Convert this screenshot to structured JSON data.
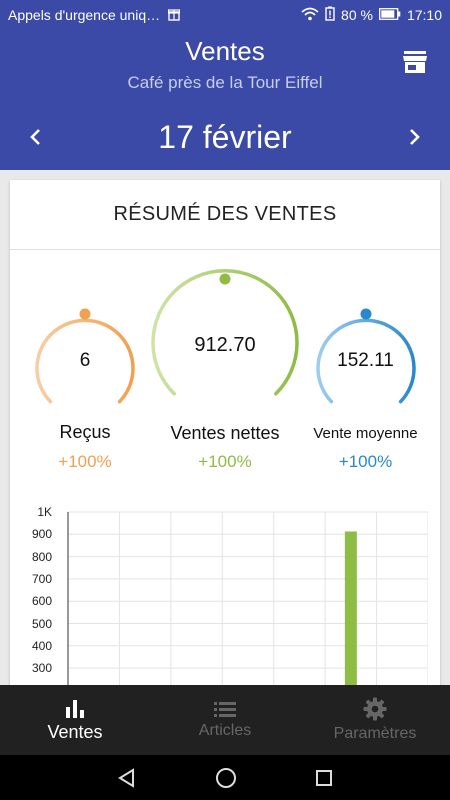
{
  "status_bar": {
    "notification": "Appels d'urgence uniq…",
    "battery": "80 %",
    "time": "17:10"
  },
  "header": {
    "title": "Ventes",
    "subtitle": "Café près de la Tour Eiffel",
    "date": "17  février",
    "store_icon": "store-icon",
    "prev_icon": "chevron-left-icon",
    "next_icon": "chevron-right-icon"
  },
  "summary": {
    "title": "RÉSUMÉ DES VENTES",
    "gauges": [
      {
        "value": "6",
        "label": "Reçus",
        "change": "+100%",
        "color": "#f0a050"
      },
      {
        "value": "912.70",
        "label": "Ventes nettes",
        "change": "+100%",
        "color": "#8fbc45"
      },
      {
        "value": "152.11",
        "label": "Vente moyenne",
        "change": "+100%",
        "color": "#2a88cc"
      }
    ]
  },
  "chart_data": {
    "type": "bar",
    "y_ticks": [
      "1K",
      "900",
      "800",
      "700",
      "600",
      "500",
      "400",
      "300"
    ],
    "ylim": [
      0,
      1000
    ],
    "values": [
      0,
      0,
      0,
      0,
      0,
      912.7,
      0
    ],
    "bar_color": "#8fbc45",
    "grid": true
  },
  "bottom_nav": [
    {
      "label": "Ventes",
      "icon": "bar-chart-icon",
      "active": true
    },
    {
      "label": "Articles",
      "icon": "list-icon",
      "active": false
    },
    {
      "label": "Paramètres",
      "icon": "gear-icon",
      "active": false
    }
  ]
}
